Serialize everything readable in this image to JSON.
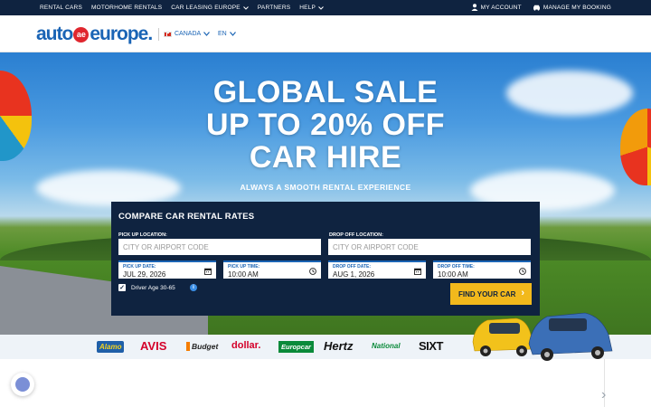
{
  "topbar": {
    "nav": [
      "RENTAL CARS",
      "MOTORHOME RENTALS",
      "CAR LEASING EUROPE",
      "PARTNERS",
      "HELP"
    ],
    "my_account": "MY ACCOUNT",
    "manage_booking": "MANAGE MY BOOKING"
  },
  "header": {
    "logo_left": "auto",
    "logo_mark": "ae",
    "logo_right": "europe",
    "country": "CANADA",
    "language": "EN"
  },
  "hero": {
    "headline": [
      "GLOBAL SALE",
      "UP TO 20% OFF",
      "CAR HIRE"
    ],
    "tagline": "ALWAYS A SMOOTH RENTAL EXPERIENCE"
  },
  "search": {
    "title": "COMPARE CAR RENTAL RATES",
    "pickup_label": "PICK UP LOCATION:",
    "pickup_placeholder": "CITY OR AIRPORT CODE",
    "dropoff_label": "DROP OFF LOCATION:",
    "dropoff_placeholder": "CITY OR AIRPORT CODE",
    "pickup_date_label": "PICK UP DATE:",
    "pickup_date": "JUL 29, 2026",
    "pickup_time_label": "PICK UP TIME:",
    "pickup_time": "10:00 AM",
    "dropoff_date_label": "DROP OFF DATE:",
    "dropoff_date": "AUG 1, 2026",
    "dropoff_time_label": "DROP OFF TIME:",
    "dropoff_time": "10:00 AM",
    "driver_age": "Driver Age 30-65",
    "driver_age_checked": true,
    "button": "FIND YOUR CAR"
  },
  "brands": [
    "Alamo",
    "AVIS",
    "Budget",
    "dollar.",
    "Europcar",
    "Hertz",
    "National",
    "SIXT"
  ],
  "colors": {
    "navy": "#0f2340",
    "brand_blue": "#1a64b5",
    "cta_yellow": "#f2b91c",
    "logo_red": "#e0262e"
  }
}
